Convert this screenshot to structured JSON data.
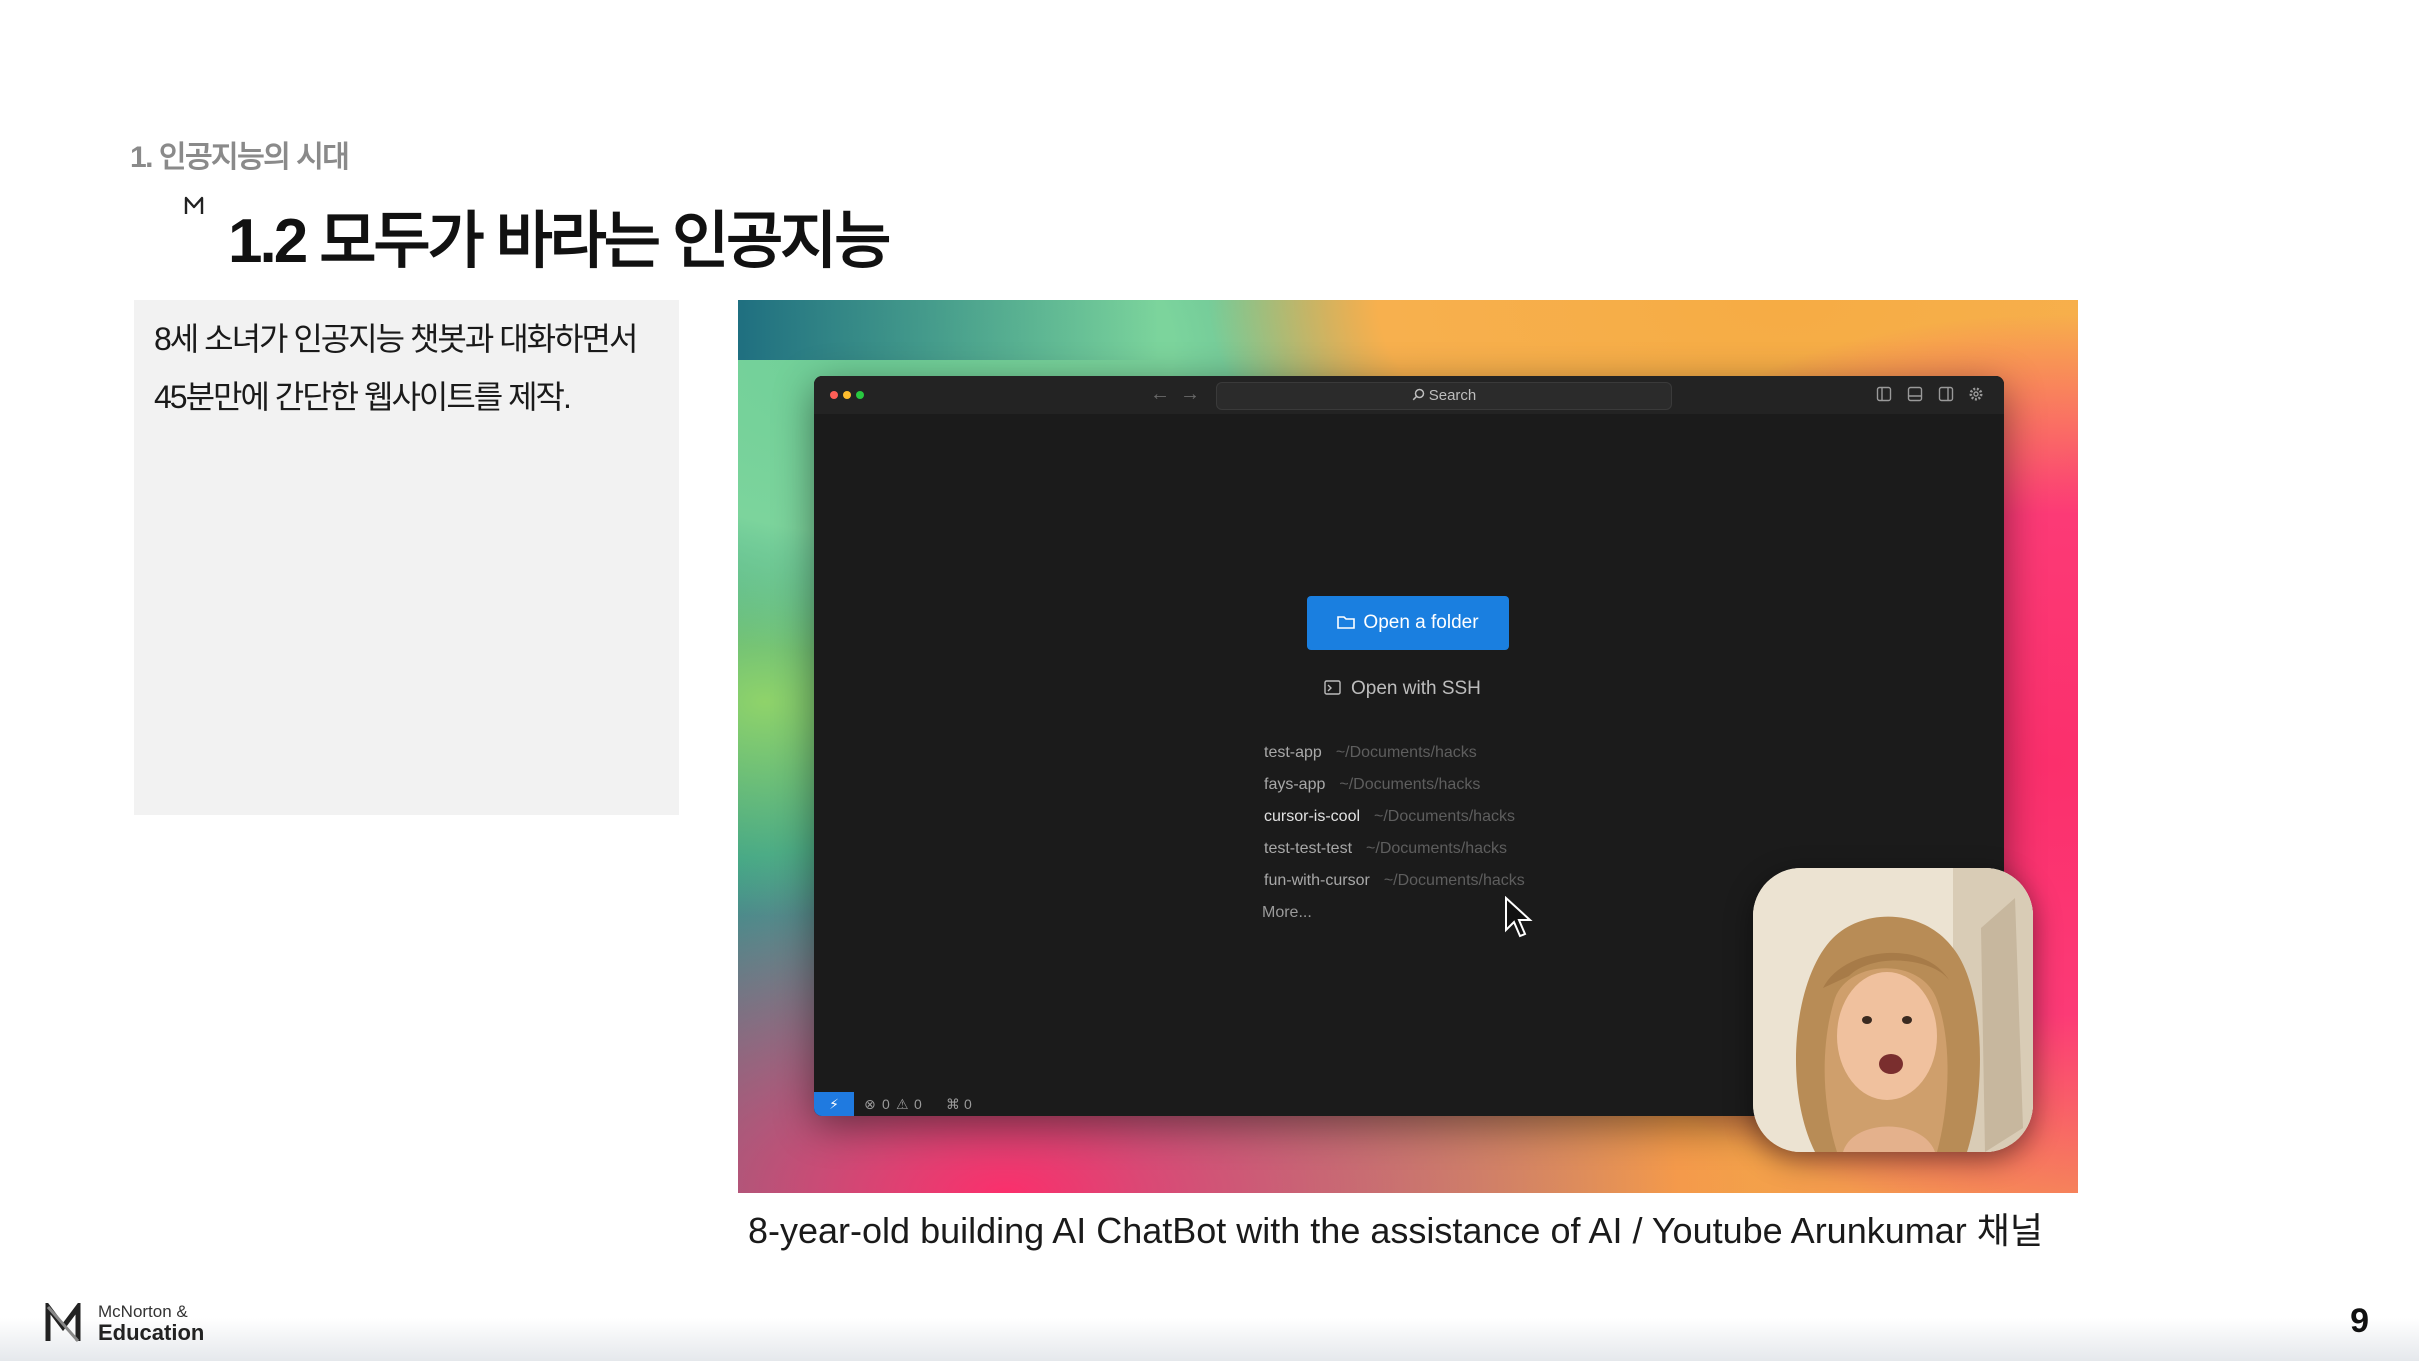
{
  "header": {
    "section": "1. 인공지능의 시대",
    "title": "1.2 모두가 바라는 인공지능"
  },
  "description": {
    "lines": [
      "8세 소녀가 인공지능 챗봇과 대화하면서",
      "45분만에 간단한 웹사이트를 제작."
    ]
  },
  "editor": {
    "search_label": "Search",
    "open_folder_label": "Open a folder",
    "open_ssh_label": "Open with SSH",
    "recent": [
      {
        "name": "test-app",
        "path": "~/Documents/hacks"
      },
      {
        "name": "fays-app",
        "path": "~/Documents/hacks"
      },
      {
        "name": "cursor-is-cool",
        "path": "~/Documents/hacks"
      },
      {
        "name": "test-test-test",
        "path": "~/Documents/hacks"
      },
      {
        "name": "fun-with-cursor",
        "path": "~/Documents/hacks"
      }
    ],
    "more_label": "More...",
    "status": {
      "errors": "0",
      "warnings": "0",
      "ports": "0"
    },
    "colors": {
      "accent": "#1a7fe0",
      "traffic_red": "#ff5f57",
      "traffic_yellow": "#febc2e",
      "traffic_green": "#28c840"
    }
  },
  "caption": "8-year-old building AI ChatBot with the assistance of AI / Youtube Arunkumar 채널",
  "footer": {
    "brand_line1": "McNorton &",
    "brand_line2": "Education",
    "page_number": "9"
  }
}
